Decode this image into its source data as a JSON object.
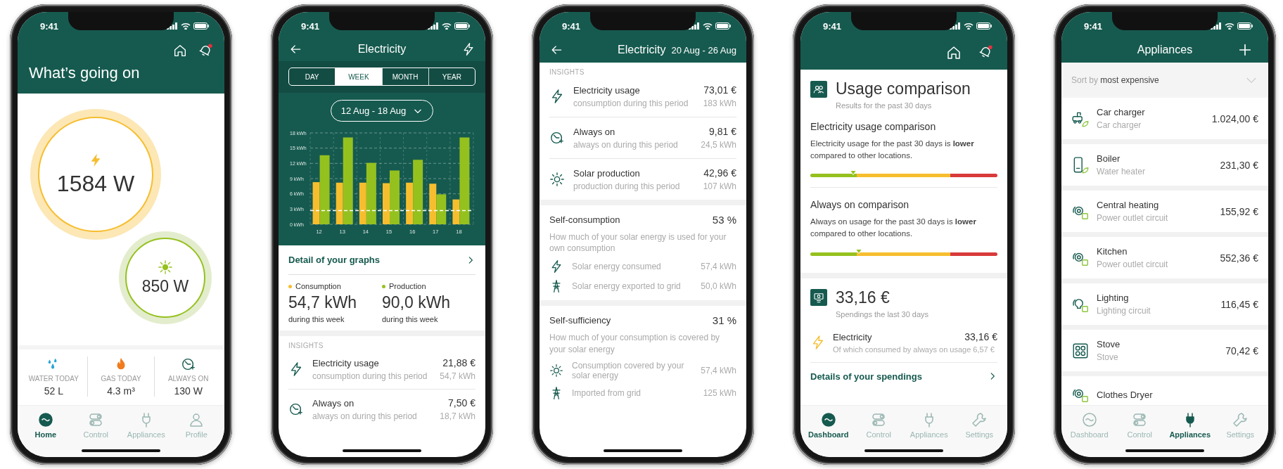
{
  "phones": [
    {
      "kind": "home",
      "status_time": "9:41",
      "header": {
        "title": "What’s going on",
        "notification": true
      },
      "consumption": {
        "value": "1584 W"
      },
      "production": {
        "value": "850 W"
      },
      "stats": [
        {
          "kind": "water",
          "label": "WATER TODAY",
          "value": "52 L"
        },
        {
          "kind": "gas",
          "label": "GAS TODAY",
          "value": "4.3 m³"
        },
        {
          "kind": "always_on",
          "label": "ALWAYS ON",
          "value": "130 W"
        }
      ],
      "tab_bar": [
        {
          "kind": "home",
          "label": "Home",
          "selected": true
        },
        {
          "kind": "control",
          "label": "Control",
          "selected": false
        },
        {
          "kind": "appliances",
          "label": "Appliances",
          "selected": false
        },
        {
          "kind": "profile",
          "label": "Profile",
          "selected": false
        }
      ]
    },
    {
      "kind": "electricity_week",
      "status_time": "9:41",
      "title": "Electricity",
      "segments": [
        {
          "label": "DAY",
          "selected": false
        },
        {
          "label": "WEEK",
          "selected": true
        },
        {
          "label": "MONTH",
          "selected": false
        },
        {
          "label": "YEAR",
          "selected": false
        }
      ],
      "date_range": "12 Aug - 18 Aug",
      "chart_data": {
        "type": "bar",
        "categories": [
          "12",
          "13",
          "14",
          "15",
          "16",
          "17",
          "18"
        ],
        "ylim": [
          0,
          18
        ],
        "yticks": [
          {
            "value": 0,
            "label": "0 kWh"
          },
          {
            "value": 3,
            "label": "3 kWh"
          },
          {
            "value": 6,
            "label": "6 kWh"
          },
          {
            "value": 9,
            "label": "9 kWh"
          },
          {
            "value": 12,
            "label": "12 kWh"
          },
          {
            "value": 15,
            "label": "15 kWh"
          },
          {
            "value": 18,
            "label": "18 kWh"
          }
        ],
        "series": [
          {
            "name": "Consumption",
            "color": "#f6be2f",
            "values": [
              8.3,
              8.2,
              8.2,
              8.1,
              8.2,
              8.0,
              4.9
            ]
          },
          {
            "name": "Production",
            "color": "#95c11f",
            "values": [
              13.6,
              17.1,
              12.1,
              10.6,
              12.7,
              5.9,
              17.1
            ]
          }
        ],
        "grid": true,
        "ref_lines": [
          {
            "value": 2.7,
            "axis": "y"
          }
        ]
      },
      "detail_link": "Detail of your graphs",
      "totals": [
        {
          "value": "54,7 kWh",
          "period": "during this week"
        },
        {
          "value": "90,0 kWh",
          "period": "during this week"
        }
      ],
      "insights_heading": "INSIGHTS",
      "insights": [
        {
          "kind": "electricity",
          "title": "Electricity usage",
          "subtitle": "consumption during this period",
          "amount": "21,88 €",
          "energy": "54,7 kWh"
        },
        {
          "kind": "always_on",
          "title": "Always on",
          "subtitle": "always on during this period",
          "amount": "7,50 €",
          "energy": "18,7 kWh"
        }
      ]
    },
    {
      "kind": "electricity_period",
      "status_time": "9:41",
      "title": "Electricity",
      "date_range": "20 Aug - 26 Aug",
      "insights_heading": "INSIGHTS",
      "insights": [
        {
          "kind": "electricity",
          "title": "Electricity usage",
          "subtitle": "consumption during this period",
          "amount": "73,01 €",
          "energy": "183 kWh"
        },
        {
          "kind": "always_on",
          "title": "Always on",
          "subtitle": "always on during this period",
          "amount": "9,81 €",
          "energy": "24,5 kWh"
        },
        {
          "kind": "solar",
          "title": "Solar production",
          "subtitle": "production during this period",
          "amount": "42,96 €",
          "energy": "107 kWh"
        }
      ],
      "sections": [
        {
          "title": "Self-consumption",
          "percent": "53 %",
          "description": "How much of your solar energy is used for your own consumption",
          "rows": [
            {
              "kind": "electricity",
              "label": "Solar energy consumed",
              "value": "57,4 kWh"
            },
            {
              "kind": "grid",
              "label": "Solar energy exported to grid",
              "value": "50,0 kWh"
            }
          ]
        },
        {
          "title": "Self-sufficiency",
          "percent": "31 %",
          "description": "How much of your consumption is covered by your solar energy",
          "rows": [
            {
              "kind": "solar",
              "label": "Consumption covered by your solar energy",
              "value": "57,4 kWh"
            },
            {
              "kind": "grid",
              "label": "Imported from grid",
              "value": "125 kWh"
            }
          ]
        }
      ]
    },
    {
      "kind": "dashboard",
      "status_time": "9:41",
      "header": {
        "notification": true
      },
      "comparison": {
        "title": "Usage comparison",
        "subtitle": "Results for the past 30 days",
        "items": [
          {
            "title": "Electricity usage comparison",
            "text": "Electricity usage for the past 30 days is **lower** compared to other locations.",
            "level": 0.23
          },
          {
            "title": "Always on comparison",
            "text": "Always on usage for the past 30 days is **lower** compared to other locations.",
            "level": 0.26
          }
        ]
      },
      "spending": {
        "amount": "33,16 €",
        "subtitle": "Spendings the last 30 days",
        "items": [
          {
            "kind": "electricity",
            "title": "Electricity",
            "subtitle": "Of which consumed by always on usage 6,57 €",
            "amount": "33,16 €"
          }
        ],
        "link": "Details of your spendings"
      },
      "tab_bar": [
        {
          "kind": "dashboard",
          "label": "Dashboard",
          "selected": true
        },
        {
          "kind": "control",
          "label": "Control",
          "selected": false
        },
        {
          "kind": "appliances",
          "label": "Appliances",
          "selected": false
        },
        {
          "kind": "settings",
          "label": "Settings",
          "selected": false
        }
      ]
    },
    {
      "kind": "appliances",
      "status_time": "9:41",
      "title": "Appliances",
      "sort": "Sort by **most expensive**",
      "items": [
        {
          "kind": "car_charger",
          "name": "Car charger",
          "type": "Car charger",
          "cost": "1.024,00 €"
        },
        {
          "kind": "water_heater",
          "name": "Boiler",
          "type": "Water heater",
          "cost": "231,30 €"
        },
        {
          "kind": "outlet",
          "name": "Central heating",
          "type": "Power outlet circuit",
          "cost": "155,92 €"
        },
        {
          "kind": "outlet",
          "name": "Kitchen",
          "type": "Power outlet circuit",
          "cost": "552,36 €"
        },
        {
          "kind": "lighting",
          "name": "Lighting",
          "type": "Lighting circuit",
          "cost": "116,45 €"
        },
        {
          "kind": "stove",
          "name": "Stove",
          "type": "Stove",
          "cost": "70,42 €"
        },
        {
          "kind": "dryer",
          "name": "Clothes Dryer"
        }
      ],
      "tab_bar": [
        {
          "kind": "dashboard",
          "label": "Dashboard",
          "selected": false
        },
        {
          "kind": "control",
          "label": "Control",
          "selected": false
        },
        {
          "kind": "appliances",
          "label": "Appliances",
          "selected": true
        },
        {
          "kind": "settings",
          "label": "Settings",
          "selected": false
        }
      ]
    }
  ]
}
